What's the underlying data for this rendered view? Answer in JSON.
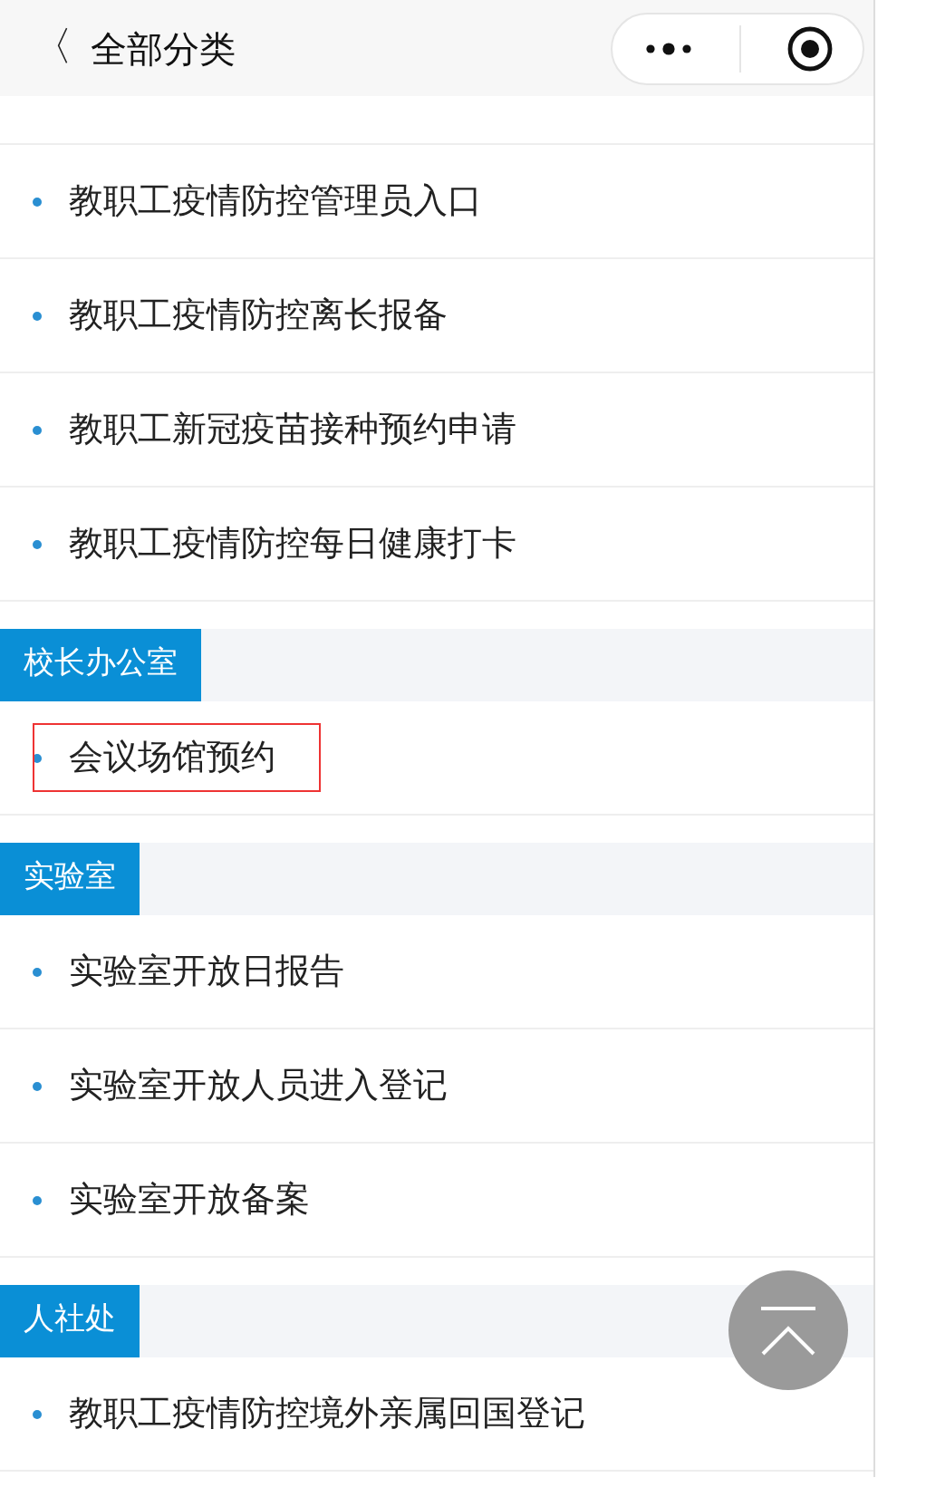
{
  "header": {
    "back": "〈",
    "title": "全部分类"
  },
  "sections": [
    {
      "items": [
        {
          "label": "教职工疫情防控管理员入口",
          "highlighted": false
        },
        {
          "label": "教职工疫情防控离长报备",
          "highlighted": false
        },
        {
          "label": "教职工新冠疫苗接种预约申请",
          "highlighted": false
        },
        {
          "label": "教职工疫情防控每日健康打卡",
          "highlighted": false
        }
      ]
    },
    {
      "title": "校长办公室",
      "items": [
        {
          "label": "会议场馆预约",
          "highlighted": true
        }
      ]
    },
    {
      "title": "实验室",
      "items": [
        {
          "label": "实验室开放日报告",
          "highlighted": false
        },
        {
          "label": "实验室开放人员进入登记",
          "highlighted": false
        },
        {
          "label": "实验室开放备案",
          "highlighted": false
        }
      ]
    },
    {
      "title": "人社处",
      "items": [
        {
          "label": "教职工疫情防控境外亲属回国登记",
          "highlighted": false
        }
      ]
    }
  ]
}
